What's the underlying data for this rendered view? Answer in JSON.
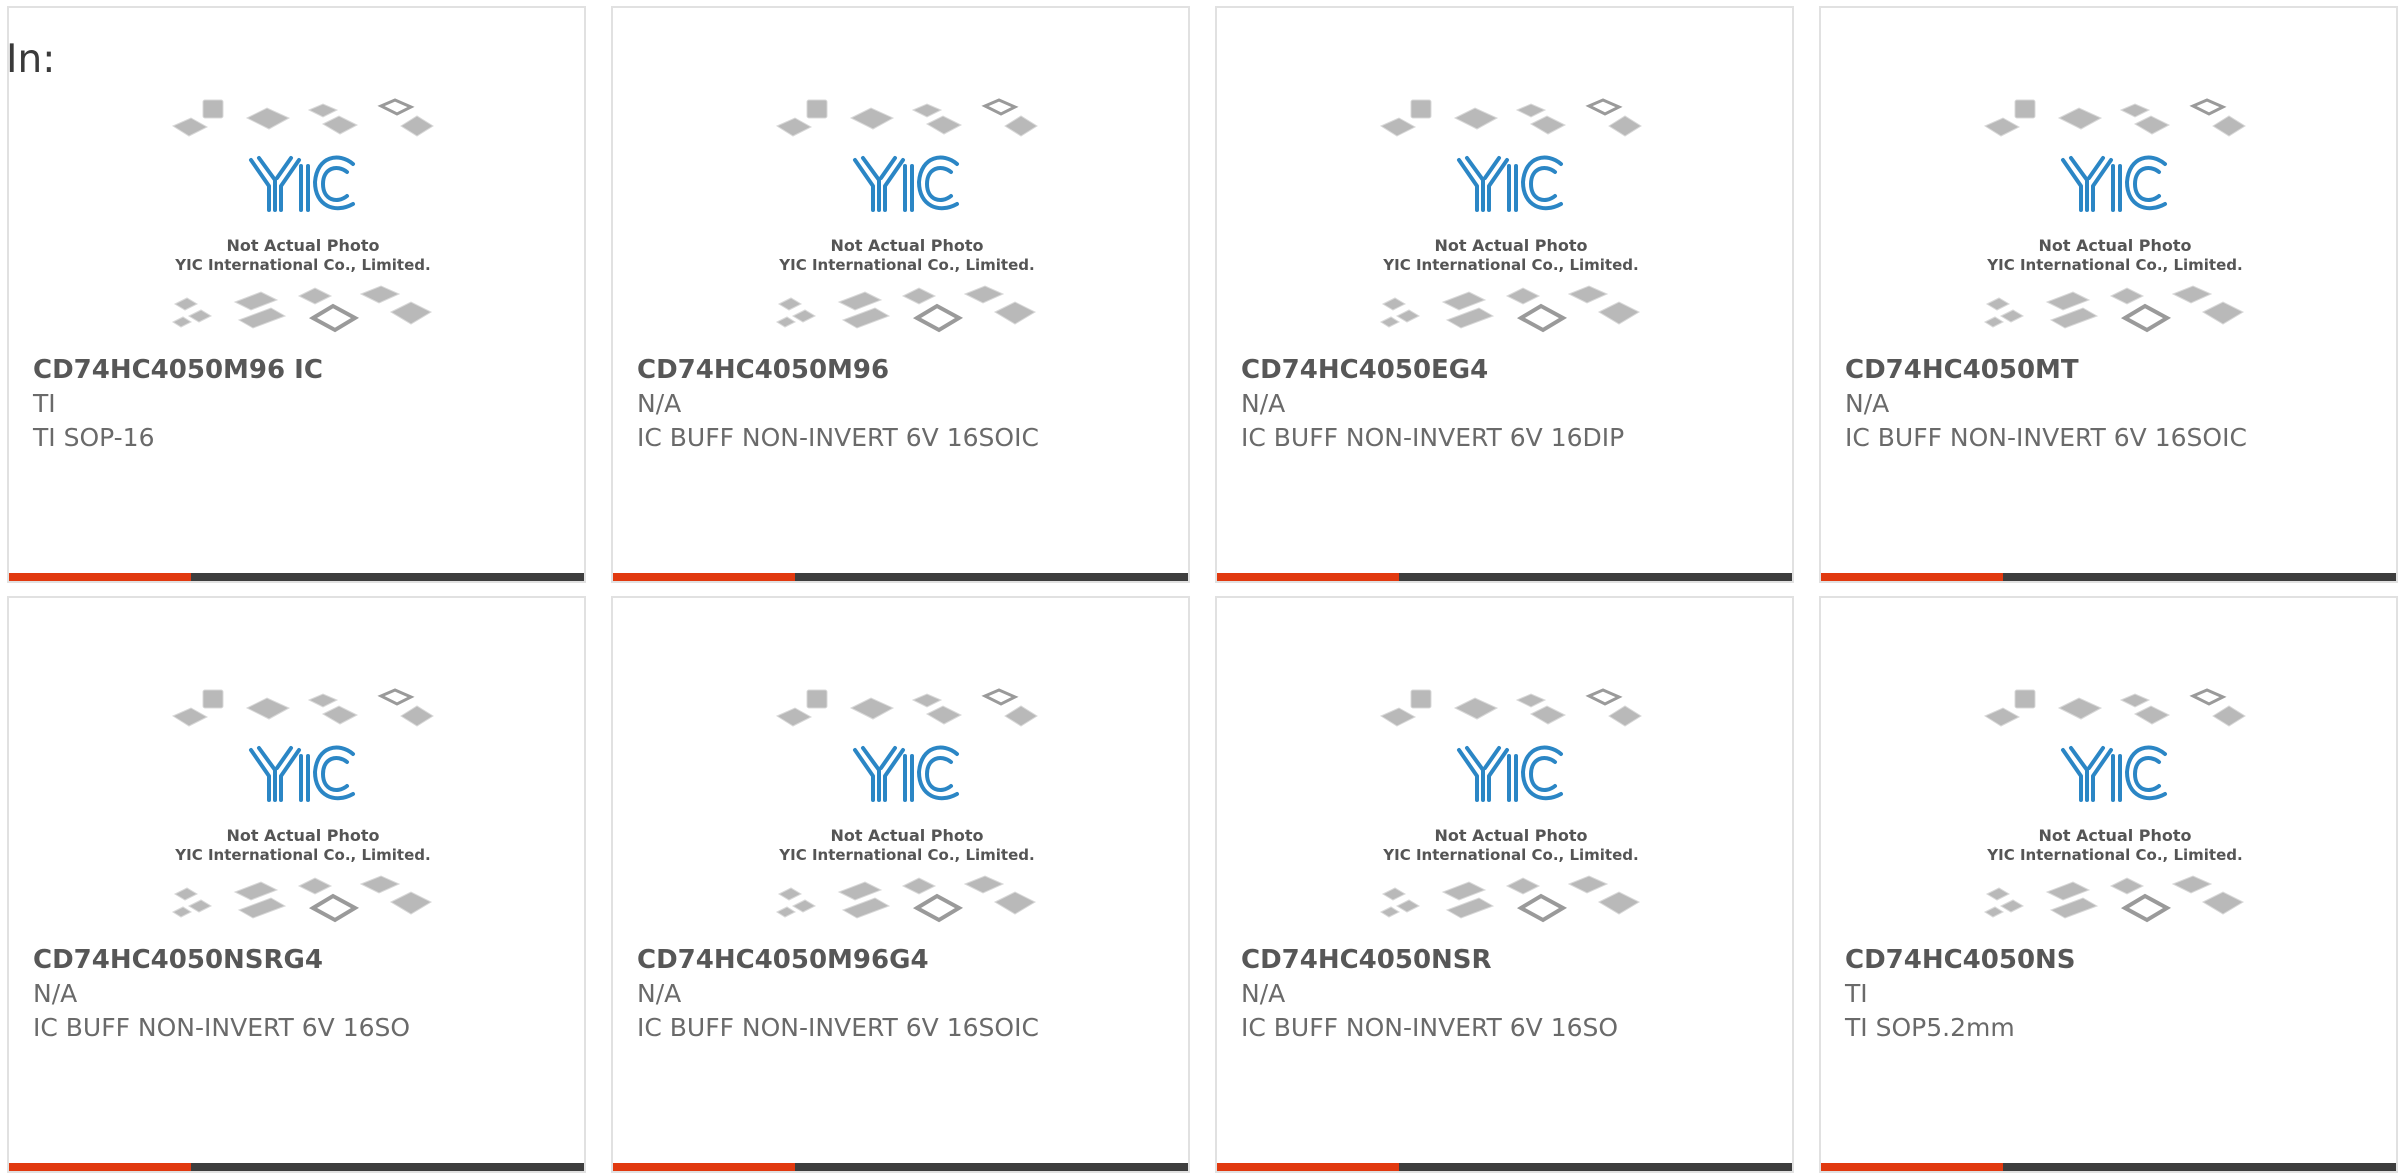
{
  "heading": "In:",
  "photo_placeholder": {
    "logo_text": "YIC",
    "line1": "Not Actual Photo",
    "line2": "YIC International Co., Limited."
  },
  "colors": {
    "accent": "#e1390f",
    "bar": "#3d3d3d",
    "border": "#e1e1e1",
    "logo_blue": "#2b86c5",
    "text_dark": "#575757",
    "text_muted": "#6a6a6a"
  },
  "products": [
    {
      "part_number": "CD74HC4050M96 IC",
      "manufacturer": "TI",
      "description": "TI SOP-16"
    },
    {
      "part_number": "CD74HC4050M96",
      "manufacturer": "N/A",
      "description": "IC BUFF NON-INVERT 6V 16SOIC"
    },
    {
      "part_number": "CD74HC4050EG4",
      "manufacturer": "N/A",
      "description": "IC BUFF NON-INVERT 6V 16DIP"
    },
    {
      "part_number": "CD74HC4050MT",
      "manufacturer": "N/A",
      "description": "IC BUFF NON-INVERT 6V 16SOIC"
    },
    {
      "part_number": "CD74HC4050NSRG4",
      "manufacturer": "N/A",
      "description": "IC BUFF NON-INVERT 6V 16SO"
    },
    {
      "part_number": "CD74HC4050M96G4",
      "manufacturer": "N/A",
      "description": "IC BUFF NON-INVERT 6V 16SOIC"
    },
    {
      "part_number": "CD74HC4050NSR",
      "manufacturer": "N/A",
      "description": "IC BUFF NON-INVERT 6V 16SO"
    },
    {
      "part_number": "CD74HC4050NS",
      "manufacturer": "TI",
      "description": "TI SOP5.2mm"
    }
  ]
}
